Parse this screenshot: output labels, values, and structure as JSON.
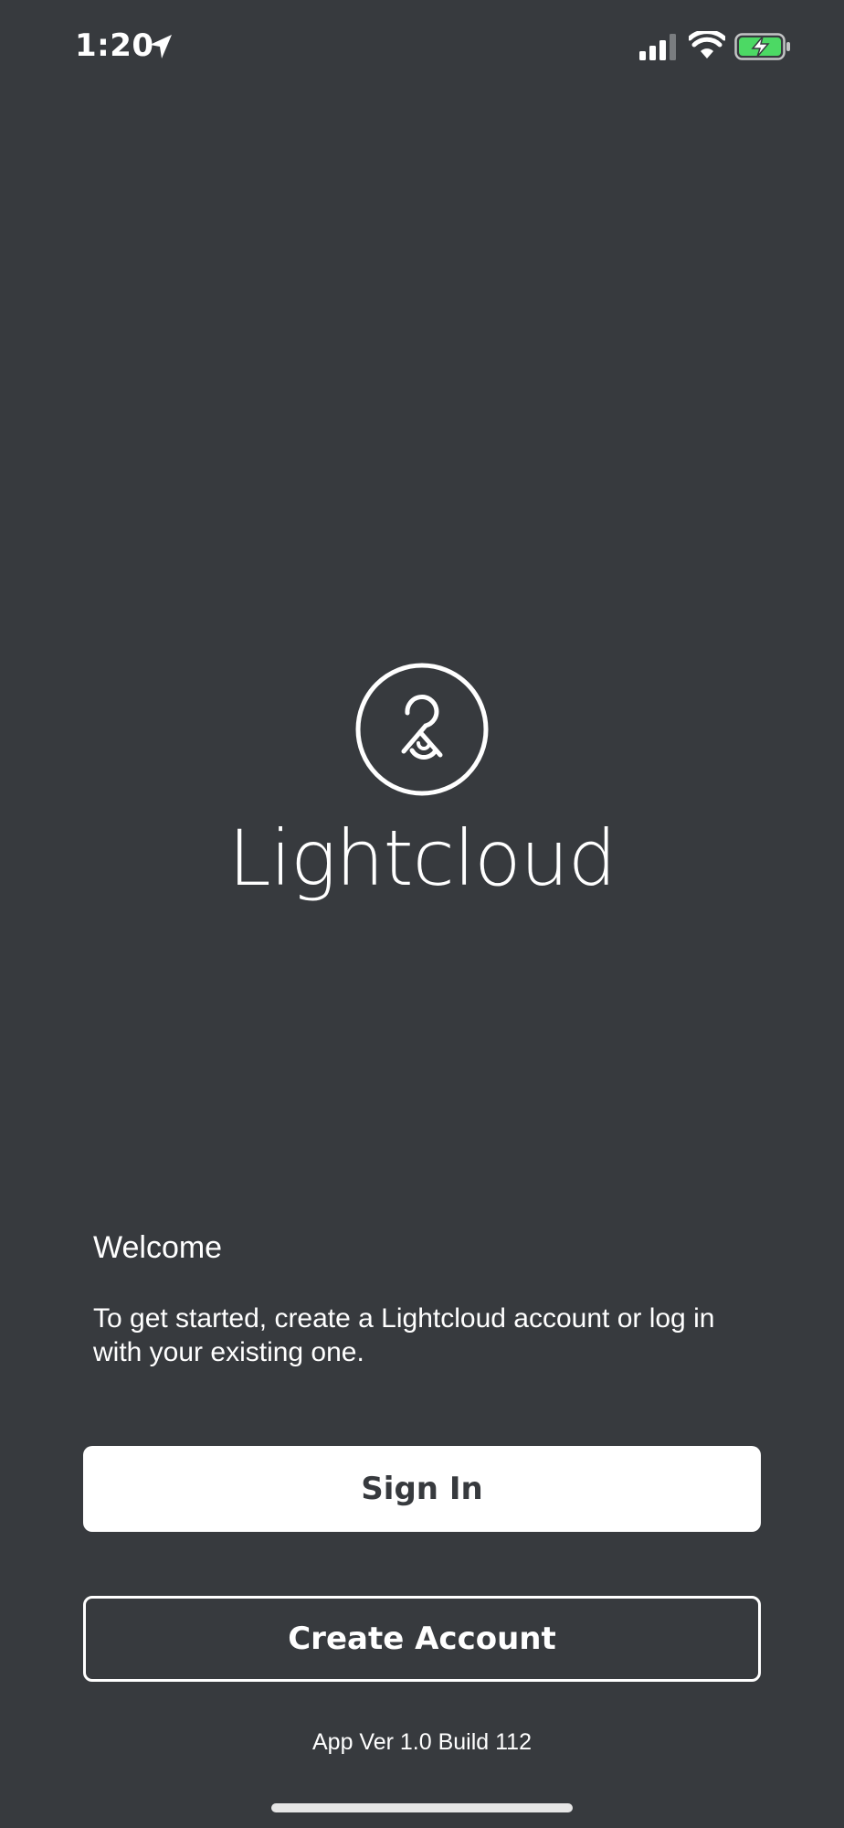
{
  "status_bar": {
    "time": "1:20",
    "icons": [
      "location-arrow-icon",
      "cellular-signal-icon",
      "wifi-icon",
      "battery-charging-icon"
    ],
    "battery_color": "#4cd964"
  },
  "brand": {
    "name": "Lightcloud",
    "logo_icon": "lightcloud-logo-icon"
  },
  "welcome": {
    "title": "Welcome",
    "text": "To get started, create a Lightcloud account or log in with your existing one."
  },
  "buttons": {
    "sign_in": "Sign In",
    "create_account": "Create Account"
  },
  "footer": {
    "version": "App Ver 1.0 Build 112"
  },
  "colors": {
    "background": "#373a3e",
    "foreground": "#ffffff"
  }
}
